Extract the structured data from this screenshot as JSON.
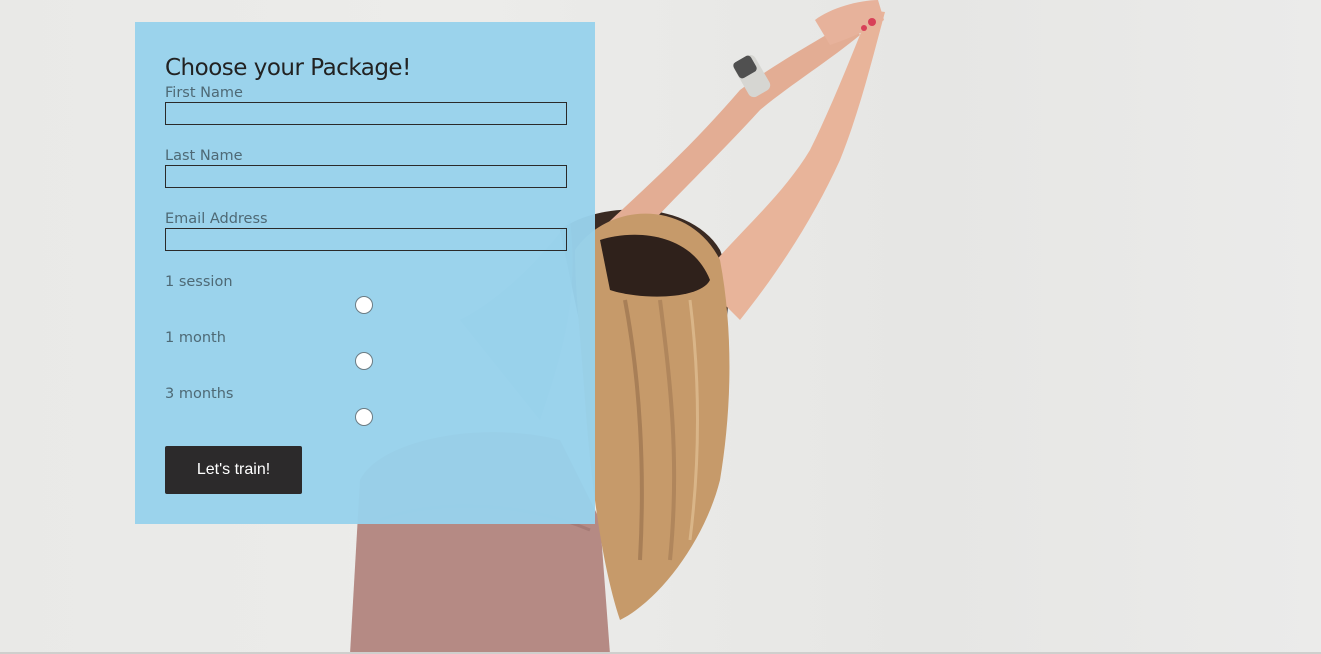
{
  "form": {
    "title": "Choose your Package!",
    "fields": {
      "first_name_label": "First Name",
      "first_name_value": "",
      "last_name_label": "Last Name",
      "last_name_value": "",
      "email_label": "Email Address",
      "email_value": ""
    },
    "packages": [
      {
        "label": "1 session",
        "selected": false
      },
      {
        "label": "1 month",
        "selected": false
      },
      {
        "label": "3 months",
        "selected": false
      }
    ],
    "submit_label": "Let's train!"
  },
  "colors": {
    "panel_background": "#98d2eb",
    "button_background": "#2c2a2b",
    "label_text": "#4e6975",
    "background": "#e9e9e7"
  }
}
